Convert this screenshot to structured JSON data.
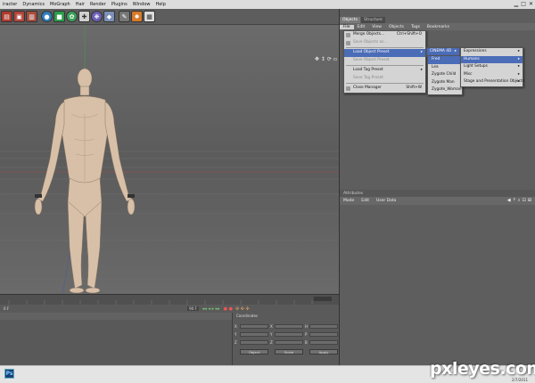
{
  "menubar": {
    "items": [
      "iracter",
      "Dynamics",
      "MoGraph",
      "Hair",
      "Render",
      "Plugins",
      "Window",
      "Help"
    ]
  },
  "toolbar": {
    "icons": [
      "film-clapper-icon",
      "film-render-icon",
      "film-settings-icon",
      "sphere-icon",
      "cube-icon",
      "gear-green-icon",
      "spline-icon",
      "flower-icon",
      "deformer-icon",
      "camera-icon",
      "light-icon",
      "scene-icon"
    ]
  },
  "object_manager": {
    "tabs": [
      "Objects",
      "Structure"
    ],
    "menu": [
      "File",
      "Edit",
      "View",
      "Objects",
      "Tags",
      "Bookmarks"
    ],
    "file_menu": [
      {
        "label": "Merge Objects...",
        "shortcut": "Ctrl+Shift+O",
        "disabled": false
      },
      {
        "label": "Save Objects as...",
        "shortcut": "",
        "disabled": true
      },
      {
        "label": "Load Object Preset",
        "shortcut": "",
        "disabled": false,
        "highlighted": true,
        "submenu": true
      },
      {
        "label": "Save Object Preset",
        "shortcut": "",
        "disabled": true
      },
      {
        "label": "Load Tag Preset",
        "shortcut": "",
        "disabled": false,
        "submenu": true
      },
      {
        "label": "Save Tag Preset",
        "shortcut": "",
        "disabled": true
      },
      {
        "label": "Close Manager",
        "shortcut": "Shift+W",
        "disabled": false
      }
    ],
    "submenu_source": "CINEMA 4D",
    "submenu_figures": [
      "Fred",
      "Lea",
      "Zygote Child",
      "Zygote Man",
      "Zygote_Woman"
    ],
    "submenu_categories": [
      "Expressions",
      "Humans",
      "Light Setups",
      "Misc",
      "Stage and Presentation Objects"
    ]
  },
  "attributes": {
    "title": "Attributes",
    "menu": [
      "Mode",
      "Edit",
      "User Data"
    ]
  },
  "timeline": {
    "start_frame": "0 F",
    "end_frame": "0 F",
    "current_frame": "90 F"
  },
  "coordinates": {
    "title": "Coordinates",
    "rows": [
      "X",
      "Y",
      "Z"
    ],
    "col_labels": [
      "H",
      "P",
      "B"
    ],
    "buttons": [
      "Object",
      "Scale",
      "Apply"
    ]
  },
  "taskbar": {
    "app_icon": "Ps",
    "clock": "2/7/2011"
  },
  "watermark": "pxleyes.com"
}
